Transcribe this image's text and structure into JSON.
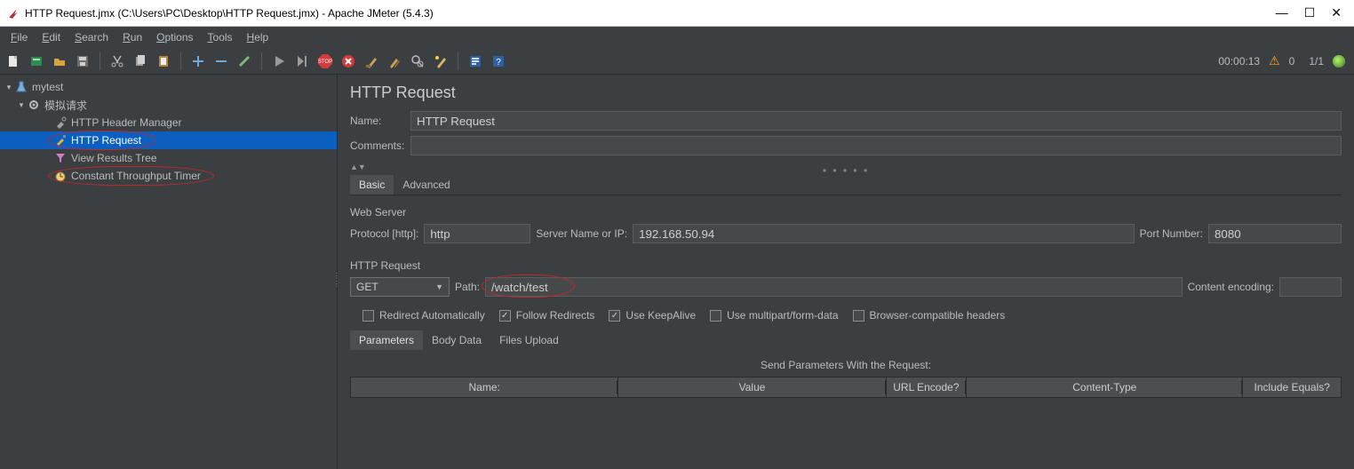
{
  "window": {
    "title": "HTTP Request.jmx (C:\\Users\\PC\\Desktop\\HTTP Request.jmx) - Apache JMeter (5.4.3)"
  },
  "menu": {
    "items": [
      "File",
      "Edit",
      "Search",
      "Run",
      "Options",
      "Tools",
      "Help"
    ]
  },
  "status": {
    "elapsed": "00:00:13",
    "errors": "0",
    "threads": "1/1"
  },
  "tree": {
    "root": "mytest",
    "group": "模拟请求",
    "children": {
      "header_mgr": "HTTP Header Manager",
      "http_request": "HTTP Request",
      "view_results": "View Results Tree",
      "throughput_timer": "Constant Throughput Timer"
    }
  },
  "editor": {
    "page_title": "HTTP Request",
    "name_label": "Name:",
    "name_value": "HTTP Request",
    "comments_label": "Comments:",
    "comments_value": "",
    "tabs": {
      "basic": "Basic",
      "advanced": "Advanced"
    }
  },
  "web_server": {
    "section": "Web Server",
    "protocol_label": "Protocol [http]:",
    "protocol_value": "http",
    "server_label": "Server Name or IP:",
    "server_value": "192.168.50.94",
    "port_label": "Port Number:",
    "port_value": "8080"
  },
  "http_request": {
    "section": "HTTP Request",
    "method": "GET",
    "path_label": "Path:",
    "path_value": "/watch/test",
    "encoding_label": "Content encoding:",
    "encoding_value": "",
    "checks": {
      "redir_auto": "Redirect Automatically",
      "follow_redir": "Follow Redirects",
      "keepalive": "Use KeepAlive",
      "multipart": "Use multipart/form-data",
      "browser_compat": "Browser-compatible headers"
    }
  },
  "body_tabs": {
    "params": "Parameters",
    "body": "Body Data",
    "files": "Files Upload"
  },
  "params_table": {
    "caption": "Send Parameters With the Request:",
    "cols": {
      "name": "Name:",
      "value": "Value",
      "enc": "URL Encode?",
      "ct": "Content-Type",
      "eq": "Include Equals?"
    }
  }
}
